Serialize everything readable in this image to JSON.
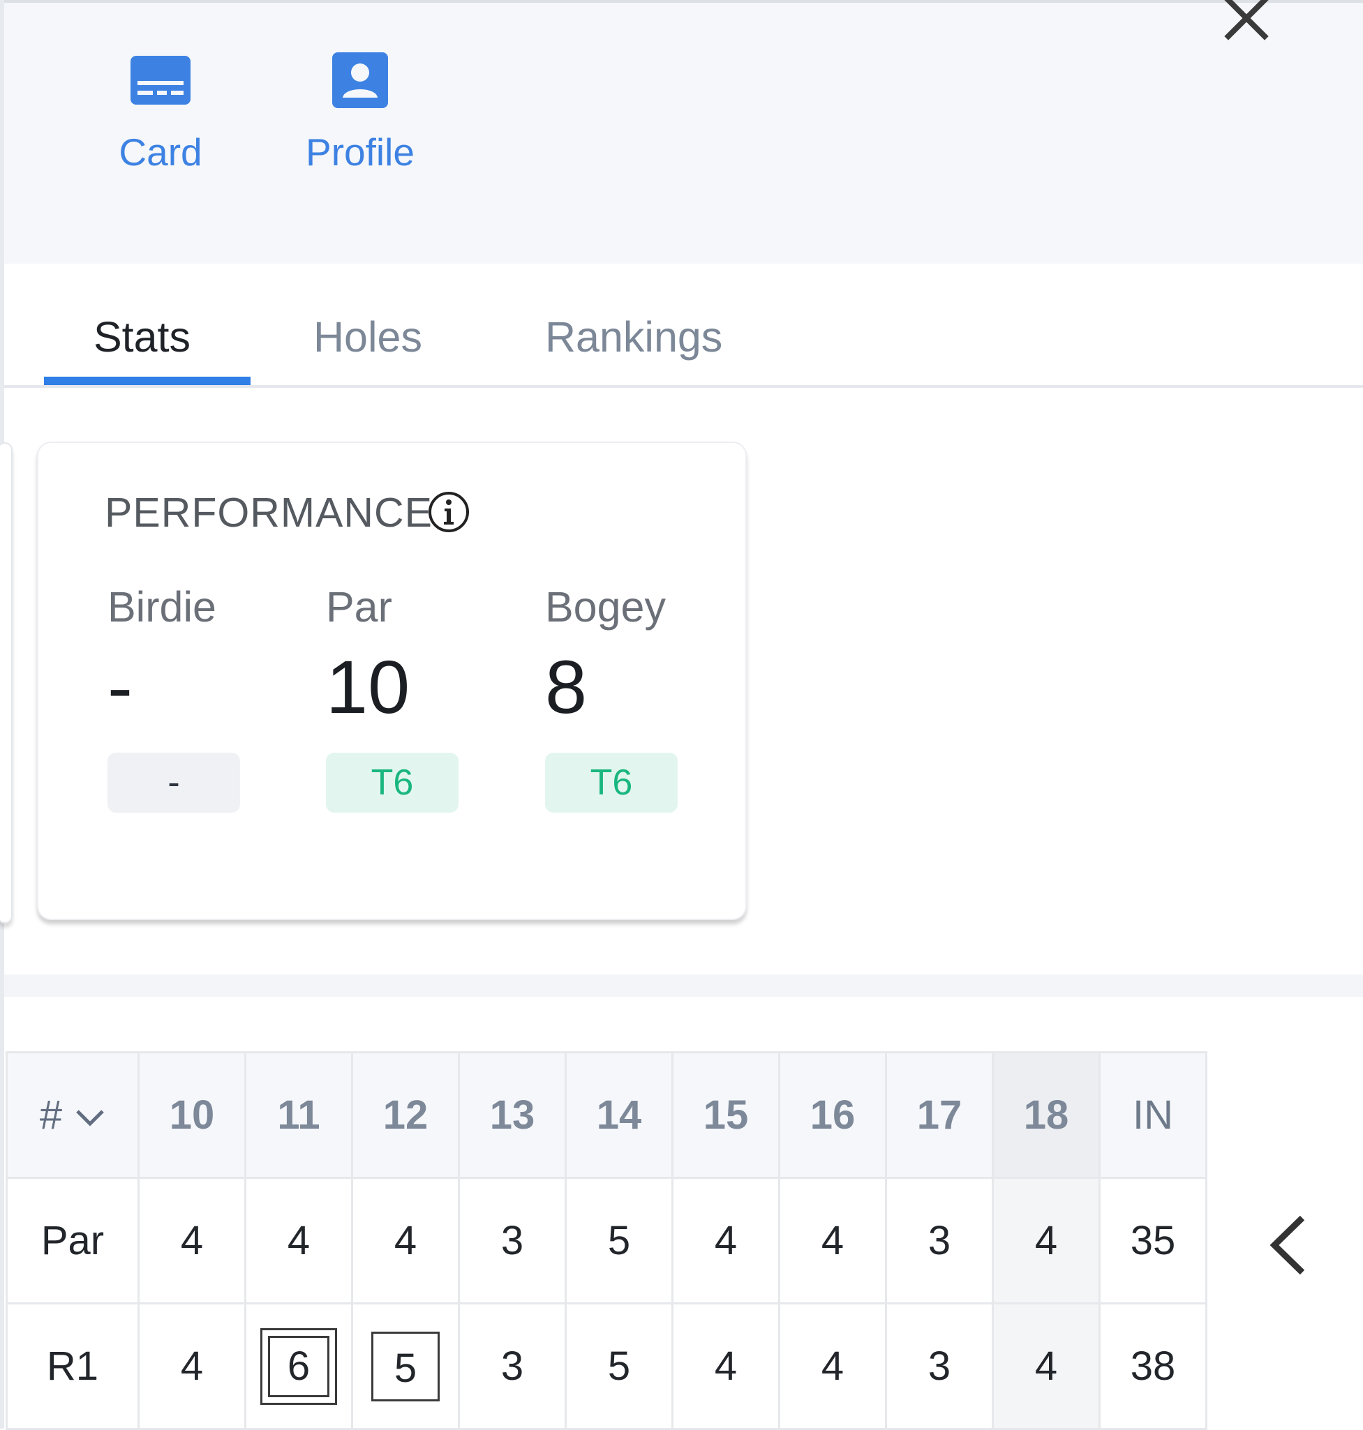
{
  "actions": {
    "card_label": "Card",
    "profile_label": "Profile"
  },
  "tabs": [
    {
      "label": "Stats",
      "active": true
    },
    {
      "label": "Holes",
      "active": false
    },
    {
      "label": "Rankings",
      "active": false
    }
  ],
  "performance": {
    "title": "PERFORMANCE",
    "stats": [
      {
        "name": "Birdie",
        "value": "-",
        "rank": "-"
      },
      {
        "name": "Par",
        "value": "10",
        "rank": "T6"
      },
      {
        "name": "Bogey",
        "value": "8",
        "rank": "T6"
      }
    ]
  },
  "scorecard": {
    "header_label": "#",
    "holes": [
      "10",
      "11",
      "12",
      "13",
      "14",
      "15",
      "16",
      "17",
      "18"
    ],
    "total_label": "IN",
    "rows": [
      {
        "label": "Par",
        "scores": [
          "4",
          "4",
          "4",
          "3",
          "5",
          "4",
          "4",
          "3",
          "4"
        ],
        "total": "35"
      },
      {
        "label": "R1",
        "scores": [
          "4",
          "6",
          "5",
          "3",
          "5",
          "4",
          "4",
          "3",
          "4"
        ],
        "total": "38"
      }
    ]
  },
  "colors": {
    "accent": "#2f7fe6",
    "action_blue": "#3d82e3",
    "rank_good_text": "#19b67f",
    "rank_good_bg": "#e2f6ef",
    "panel_bg": "#f5f7fa"
  },
  "icons": {
    "close": "close-icon",
    "card": "card-icon",
    "profile": "profile-icon",
    "info": "info-icon",
    "sort": "chevron-down-icon",
    "scroll": "chevron-left-icon"
  }
}
